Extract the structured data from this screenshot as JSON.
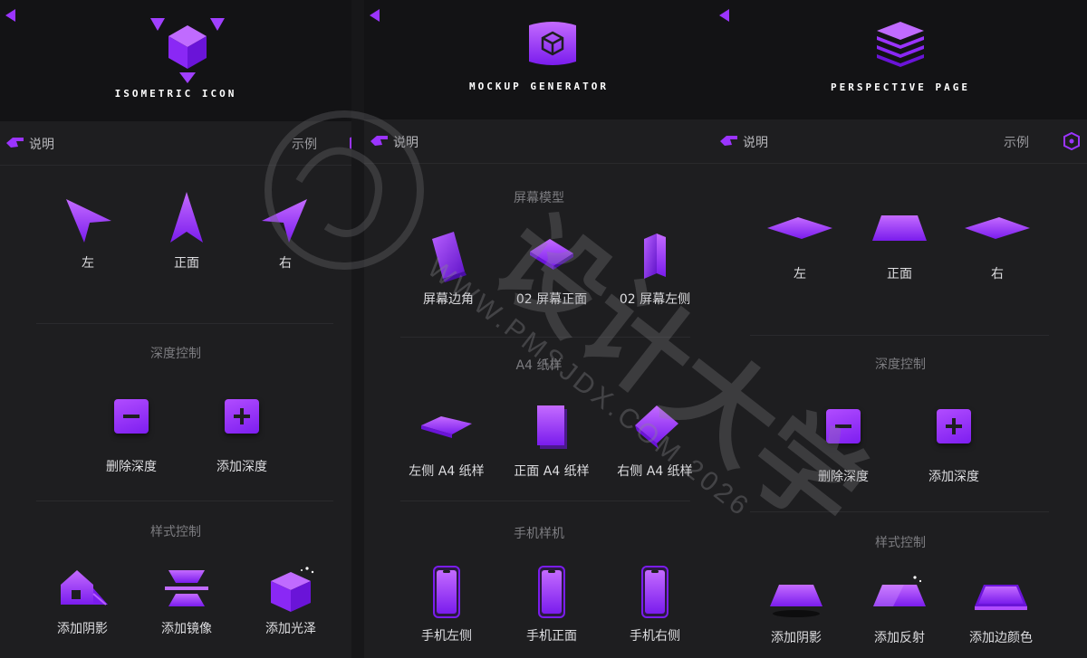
{
  "panels": [
    {
      "title": "ISOMETRIC ICON",
      "info_label": "说明",
      "example_label": "示例",
      "views": [
        "左",
        "正面",
        "右"
      ],
      "depth_title": "深度控制",
      "depth": [
        "删除深度",
        "添加深度"
      ],
      "style_title": "样式控制",
      "style": [
        "添加阴影",
        "添加镜像",
        "添加光泽"
      ]
    },
    {
      "title": "MOCKUP GENERATOR",
      "info_label": "说明",
      "screen_title": "屏幕模型",
      "screen": [
        "屏幕边角",
        "02 屏幕正面",
        "02 屏幕左侧"
      ],
      "paper_title": "A4 纸样",
      "paper": [
        "左侧 A4 纸样",
        "正面 A4 纸样",
        "右侧 A4 纸样"
      ],
      "phone_title": "手机样机",
      "phone": [
        "手机左侧",
        "手机正面",
        "手机右侧"
      ]
    },
    {
      "title": "PERSPECTIVE PAGE",
      "info_label": "说明",
      "example_label": "示例",
      "views": [
        "左",
        "正面",
        "右"
      ],
      "depth_title": "深度控制",
      "depth": [
        "删除深度",
        "添加深度"
      ],
      "style_title": "样式控制",
      "style": [
        "添加阴影",
        "添加反射",
        "添加边颜色"
      ]
    }
  ],
  "watermark": {
    "text_cn": "设计大学",
    "url": "WWW.PMSJDX.COM 2026"
  },
  "colors": {
    "accent": "#9b34ff",
    "accent_light": "#c06bff",
    "panel_bg": "#1e1e20",
    "header_bg": "#131315"
  }
}
